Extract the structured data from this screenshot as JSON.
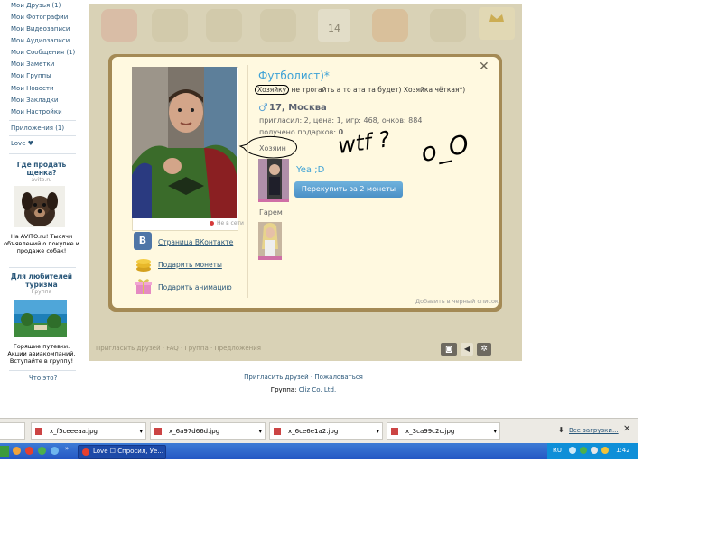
{
  "sidebar": {
    "menu": [
      "Мои Друзья (1)",
      "Мои Фотографии",
      "Мои Видеозаписи",
      "Мои Аудиозаписи",
      "Мои Сообщения (1)",
      "Мои Заметки",
      "Мои Группы",
      "Мои Новости",
      "Мои Закладки",
      "Мои Настройки"
    ],
    "apps": "Приложения (1)",
    "love": "Love ♥",
    "ad1": {
      "title": "Где продать щенка?",
      "domain": "avito.ru",
      "text": "На AVITO.ru! Тысячи объявлений о покупке и продаже собак!"
    },
    "ad2": {
      "title": "Для любителей туризма",
      "sub": "Группа",
      "text": "Горящие путевки. Акции авиакомпаний. Вступайте в группу!"
    },
    "what": "Что это?"
  },
  "app": {
    "calendar_day": "14",
    "footer": "Пригласить друзей · FAQ · Группа · Предложения"
  },
  "modal": {
    "close": "✕",
    "name": "Футболист)*",
    "status_prefix": "Хозяйку",
    "status_rest": "не трогайть а то ата та будет) Хозяйка чёткая*)",
    "gender": "♂",
    "city": "17, Москва",
    "stats": "пригласил: 2, цена: 1, игр: 468, очков: 884",
    "gifts_label": "получено подарков:",
    "gifts_count": "0",
    "owner_label": "Хозяин",
    "owner_name": "Yea ;D",
    "buy_button": "Перекупить за 2 монеты",
    "harem_label": "Гарем",
    "offline": "Не в сети",
    "vk_link": "Страница ВКонтакте",
    "coins_link": "Подарить монеты",
    "anim_link": "Подарить анимацию",
    "blacklist": "Добавить в черный список",
    "vk_letter": "B",
    "scribble_wtf": "wtf ?",
    "scribble_o": "o_O"
  },
  "page_footer": {
    "links": "Пригласить друзей · Пожаловаться",
    "group_prefix": "Группа:",
    "group_link": "Cliz Co. Ltd."
  },
  "downloads": {
    "items": [
      "x_f5ceeeaa.jpg",
      "x_6a97d66d.jpg",
      "x_6ce6e1a2.jpg",
      "x_3ca99c2c.jpg"
    ],
    "all": "Все загрузки..."
  },
  "taskbar": {
    "window": "Love ☐ Спросил, Уе...",
    "lang": "RU",
    "time": "1:42"
  },
  "colors": {
    "link": "#2b587a",
    "button": "#5aa1d4",
    "modal_bg": "#fff9e0",
    "taskbar": "#2457c4"
  }
}
